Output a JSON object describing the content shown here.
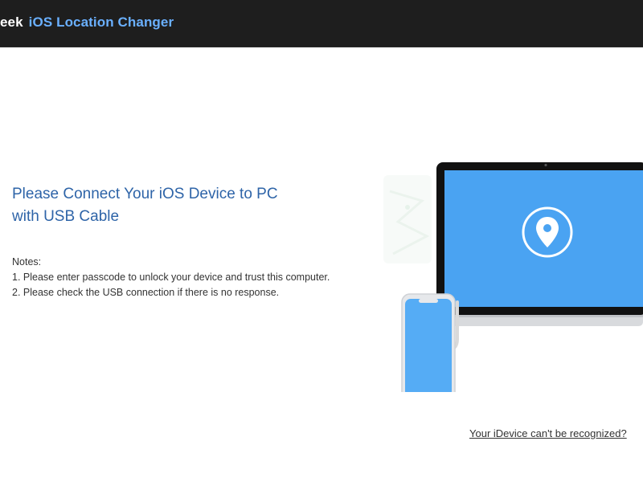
{
  "titlebar": {
    "brand_prefix": "eek",
    "brand_product": "iOS Location Changer"
  },
  "main": {
    "heading_line1": "Please Connect Your iOS Device to PC",
    "heading_line2": "with USB Cable",
    "notes_title": "Notes:",
    "notes": [
      "1. Please enter passcode to unlock your device and trust this computer.",
      "2. Please check the USB connection if there is no response."
    ],
    "help_link": "Your iDevice can't be recognized?"
  },
  "illustration": {
    "icon": "location-pin-icon",
    "screen_color": "#4aa3f2",
    "phone_screen_color": "#55acf5"
  },
  "colors": {
    "titlebar_bg": "#1e1e1e",
    "brand_accent": "#6ab0ff",
    "heading": "#2e64a8"
  }
}
